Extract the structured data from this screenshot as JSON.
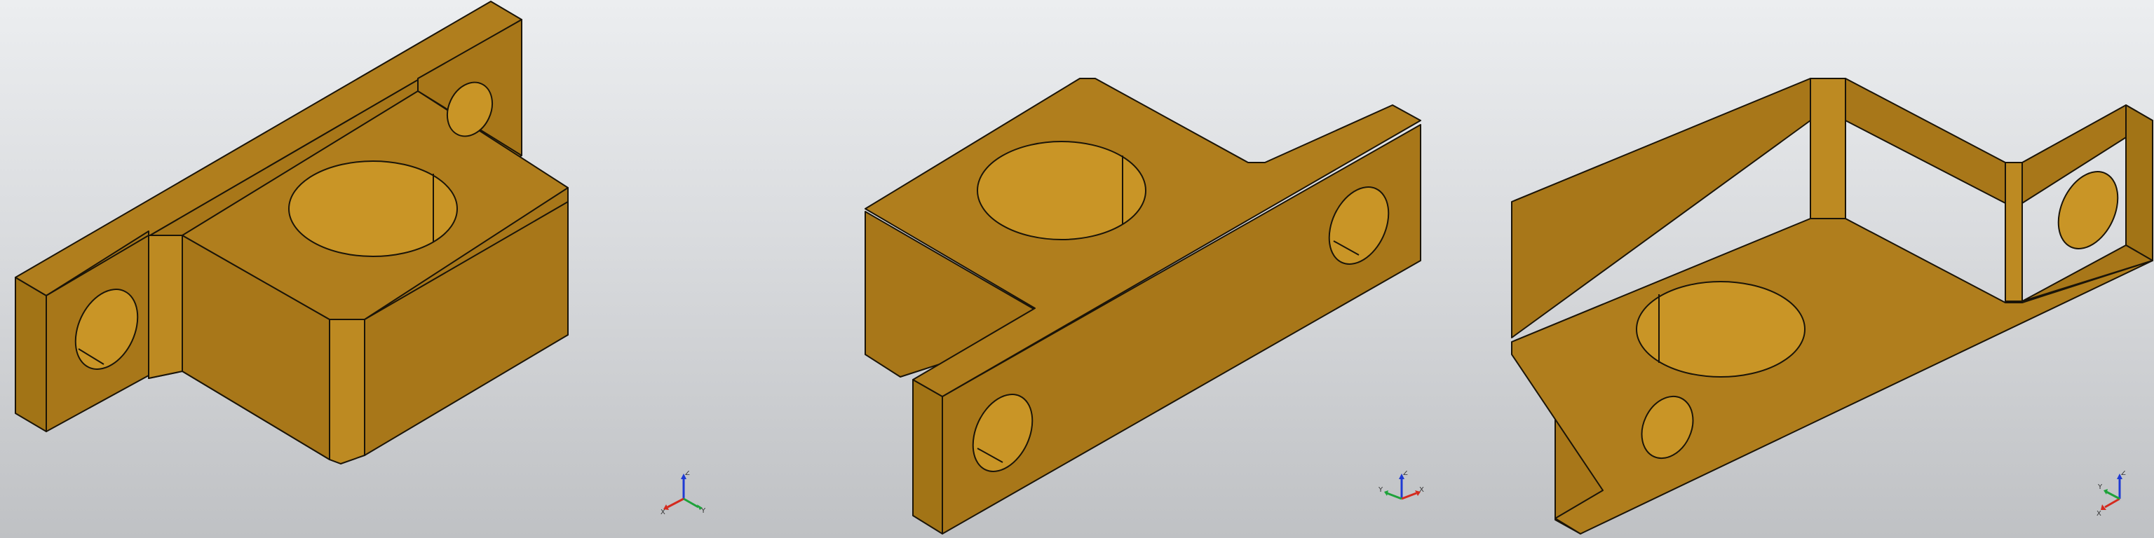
{
  "colors": {
    "part_top": "#b07e1d",
    "part_side": "#a87719",
    "part_front": "#a27416",
    "hole_inner": "#c99526",
    "edge": "#1a1408",
    "axis_x": "#d42a1e",
    "axis_y": "#1ea23a",
    "axis_z": "#1e3ad4"
  },
  "viewports": [
    {
      "triad": {
        "x_label": "X",
        "y_label": "Y",
        "z_label": "Z"
      }
    },
    {
      "triad": {
        "x_label": "X",
        "y_label": "Y",
        "z_label": "Z"
      }
    },
    {
      "triad": {
        "x_label": "X",
        "y_label": "Y",
        "z_label": "Z"
      }
    }
  ]
}
